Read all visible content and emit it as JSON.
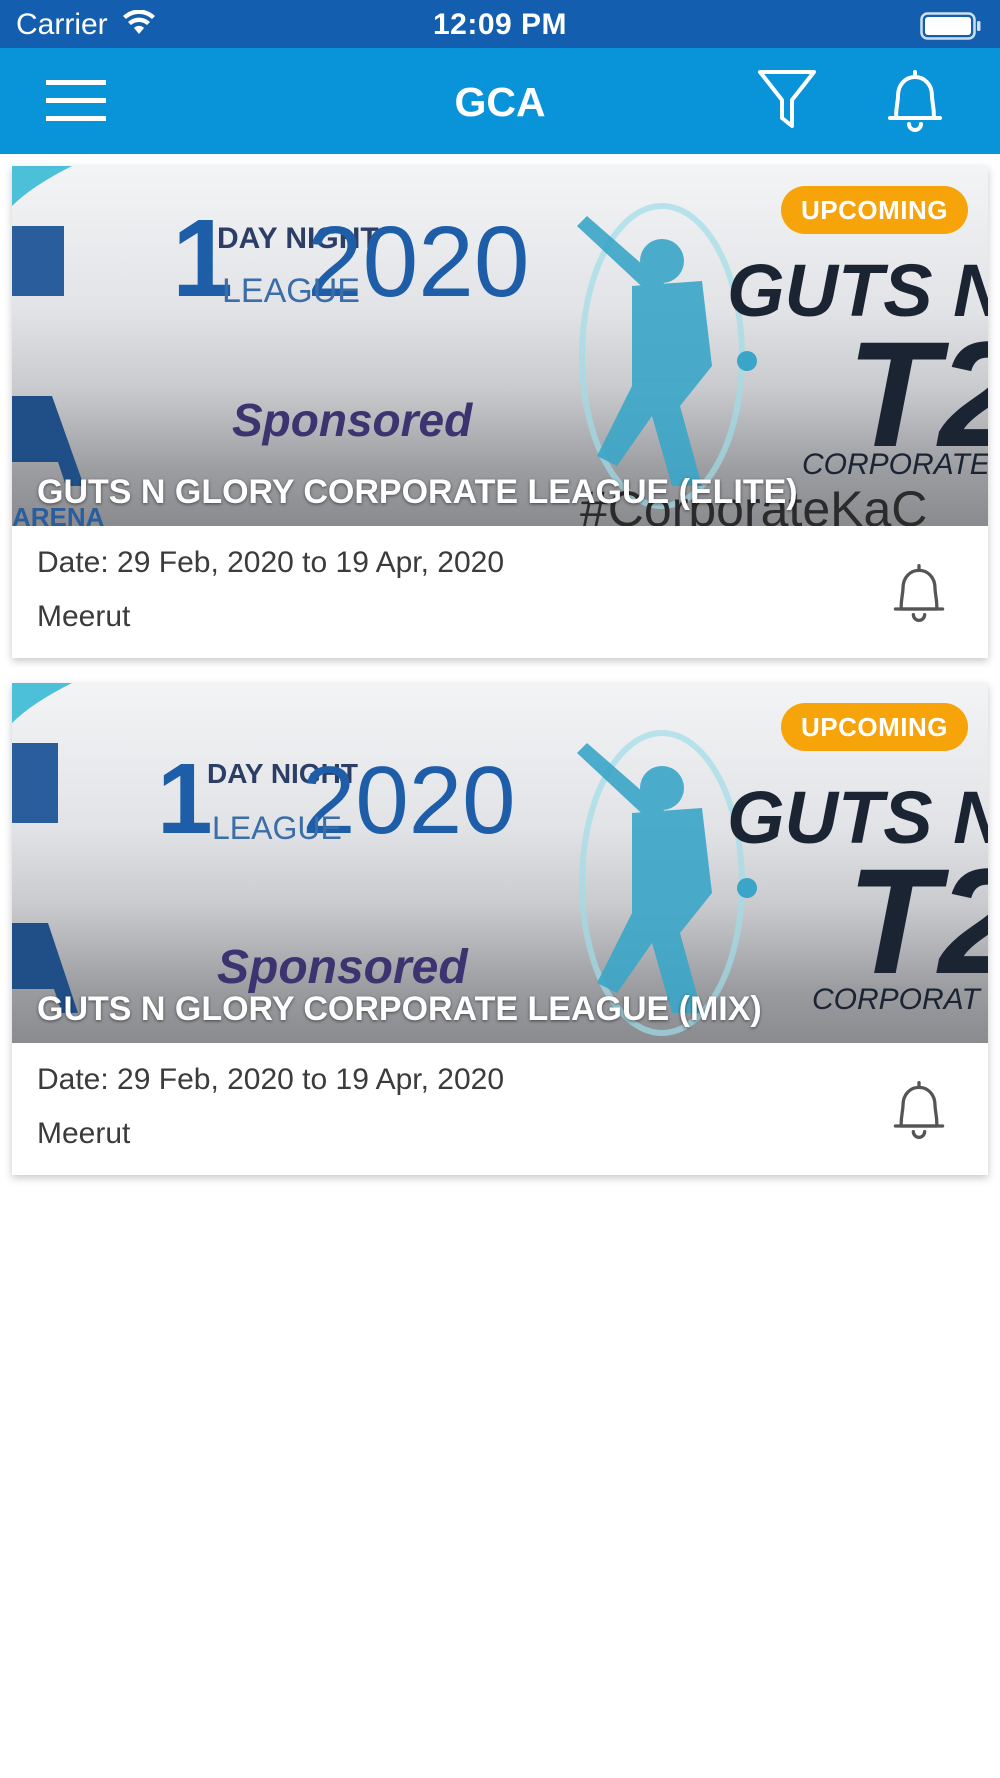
{
  "status_bar": {
    "carrier": "Carrier",
    "time": "12:09 PM",
    "wifi_icon": "wifi-icon",
    "battery_icon": "battery-icon"
  },
  "nav": {
    "title": "GCA",
    "menu_icon": "hamburger-menu-icon",
    "filter_icon": "filter-icon",
    "notification_icon": "bell-icon"
  },
  "tournaments": [
    {
      "title": "GUTS N GLORY CORPORATE LEAGUE (ELITE)",
      "badge": "UPCOMING",
      "date": "Date: 29 Feb, 2020 to 19 Apr, 2020",
      "location": "Meerut",
      "banner_texts": [
        "1",
        "DAY NIGHT",
        "2020",
        "LEAGUE",
        "Sponsored",
        "GUTS N",
        "T2",
        "CORPORATE",
        "#CorporateKaC",
        "ARENA"
      ]
    },
    {
      "title": "GUTS N GLORY CORPORATE LEAGUE (MIX)",
      "badge": "UPCOMING",
      "date": "Date: 29 Feb, 2020 to 19 Apr, 2020",
      "location": "Meerut",
      "banner_texts": [
        "1",
        "DAY NIGHT",
        "2020",
        "LEAGUE",
        "Sponsored",
        "GUTS N",
        "T2",
        "CORPORAT"
      ]
    }
  ],
  "colors": {
    "status_bar": "#135eae",
    "nav_bar": "#0993d8",
    "badge": "#f7a30a",
    "text": "#3b3b3b"
  }
}
